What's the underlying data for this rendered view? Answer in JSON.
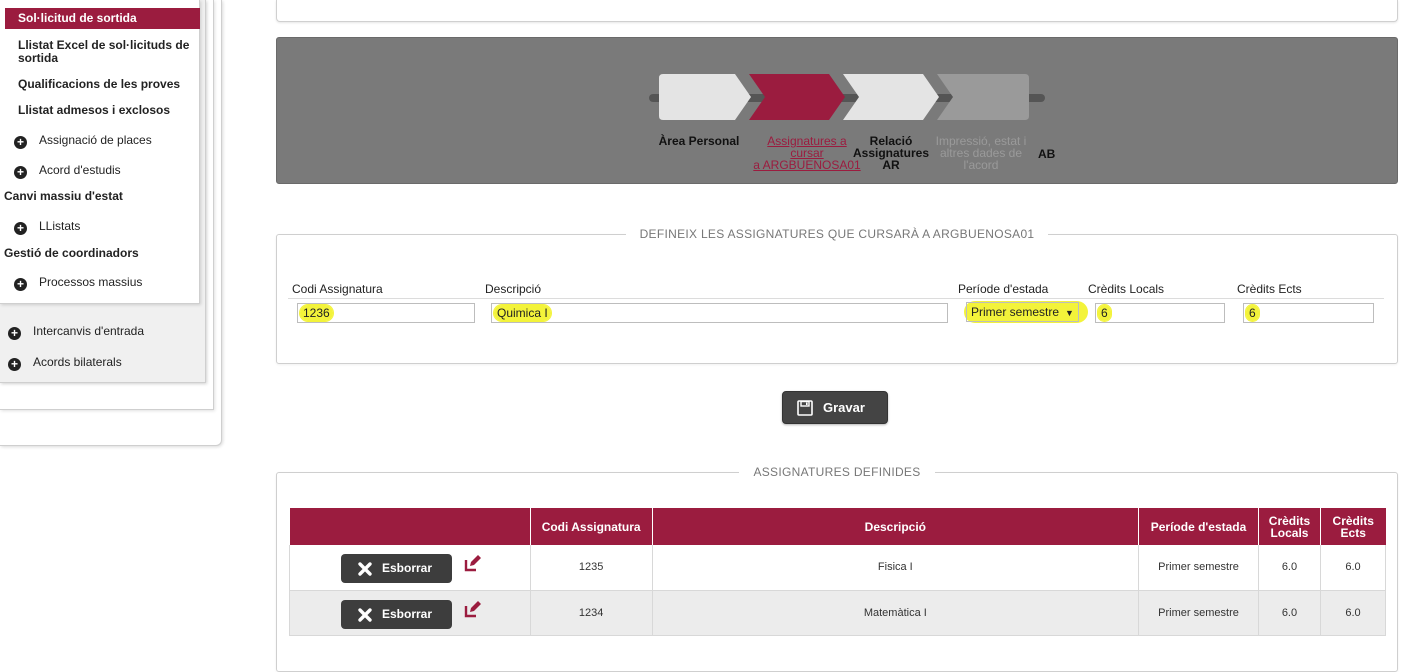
{
  "sidebar": {
    "items": [
      {
        "label": "Sol·licitud de sortida",
        "active": true
      },
      {
        "label": "Llistat Excel de sol·licituds de sortida"
      },
      {
        "label": "Qualificacions de les proves"
      },
      {
        "label": "Llistat admesos i exclosos"
      },
      {
        "label": "Assignació de places",
        "icon": "plus-circle-icon"
      },
      {
        "label": "Acord d'estudis",
        "icon": "plus-circle-icon"
      },
      {
        "label": "Canvi massiu d'estat"
      },
      {
        "label": "LListats",
        "icon": "plus-circle-icon"
      },
      {
        "label": "Gestió de coordinadors"
      },
      {
        "label": "Processos massius",
        "icon": "plus-circle-icon"
      }
    ],
    "outer_items": [
      {
        "label": "Intercanvis d'entrada",
        "icon": "plus-circle-icon"
      },
      {
        "label": "Acords bilaterals",
        "icon": "plus-circle-icon"
      }
    ],
    "active_color": "#9b1c3f"
  },
  "wizard": {
    "steps": [
      {
        "label": "Àrea Personal",
        "state": "done"
      },
      {
        "label_lines": [
          "Assignatures a",
          "cursar",
          "a ARGBUENOSA01"
        ],
        "state": "current"
      },
      {
        "label_lines": [
          "Relació",
          "Assignatures AR"
        ],
        "state": "done"
      },
      {
        "label_lines": [
          "Impressió, estat i",
          "altres dades de",
          "l'acord"
        ],
        "state": "todo"
      },
      {
        "label": "AB",
        "state": "done"
      }
    ]
  },
  "define_form": {
    "legend": "DEFINEIX LES ASSIGNATURES QUE CURSARÀ A ARGBUENOSA01",
    "labels": {
      "codi": "Codi Assignatura",
      "descripcio": "Descripció",
      "periode": "Període d'estada",
      "credits_locals": "Crèdits Locals",
      "credits_ects": "Crèdits Ects"
    },
    "values": {
      "codi": "1236",
      "descripcio": "Quimica I",
      "periode": "Primer semestre",
      "credits_locals": "6",
      "credits_ects": "6"
    },
    "highlight_color": "#f3f33a"
  },
  "save_button": {
    "label": "Gravar",
    "icon": "floppy-disk-icon"
  },
  "defined_table": {
    "legend": "ASSIGNATURES DEFINIDES",
    "headers": [
      "",
      "Codi Assignatura",
      "Descripció",
      "Període d'estada",
      "Crèdits Locals",
      "Crèdits Ects"
    ],
    "header_color": "#9b1c3f",
    "rows": [
      {
        "action": "Esborrar",
        "codi": "1235",
        "descripcio": "Fisica I",
        "periode": "Primer semestre",
        "locals": "6.0",
        "ects": "6.0"
      },
      {
        "action": "Esborrar",
        "codi": "1234",
        "descripcio": "Matemàtica I",
        "periode": "Primer semestre",
        "locals": "6.0",
        "ects": "6.0"
      }
    ]
  }
}
